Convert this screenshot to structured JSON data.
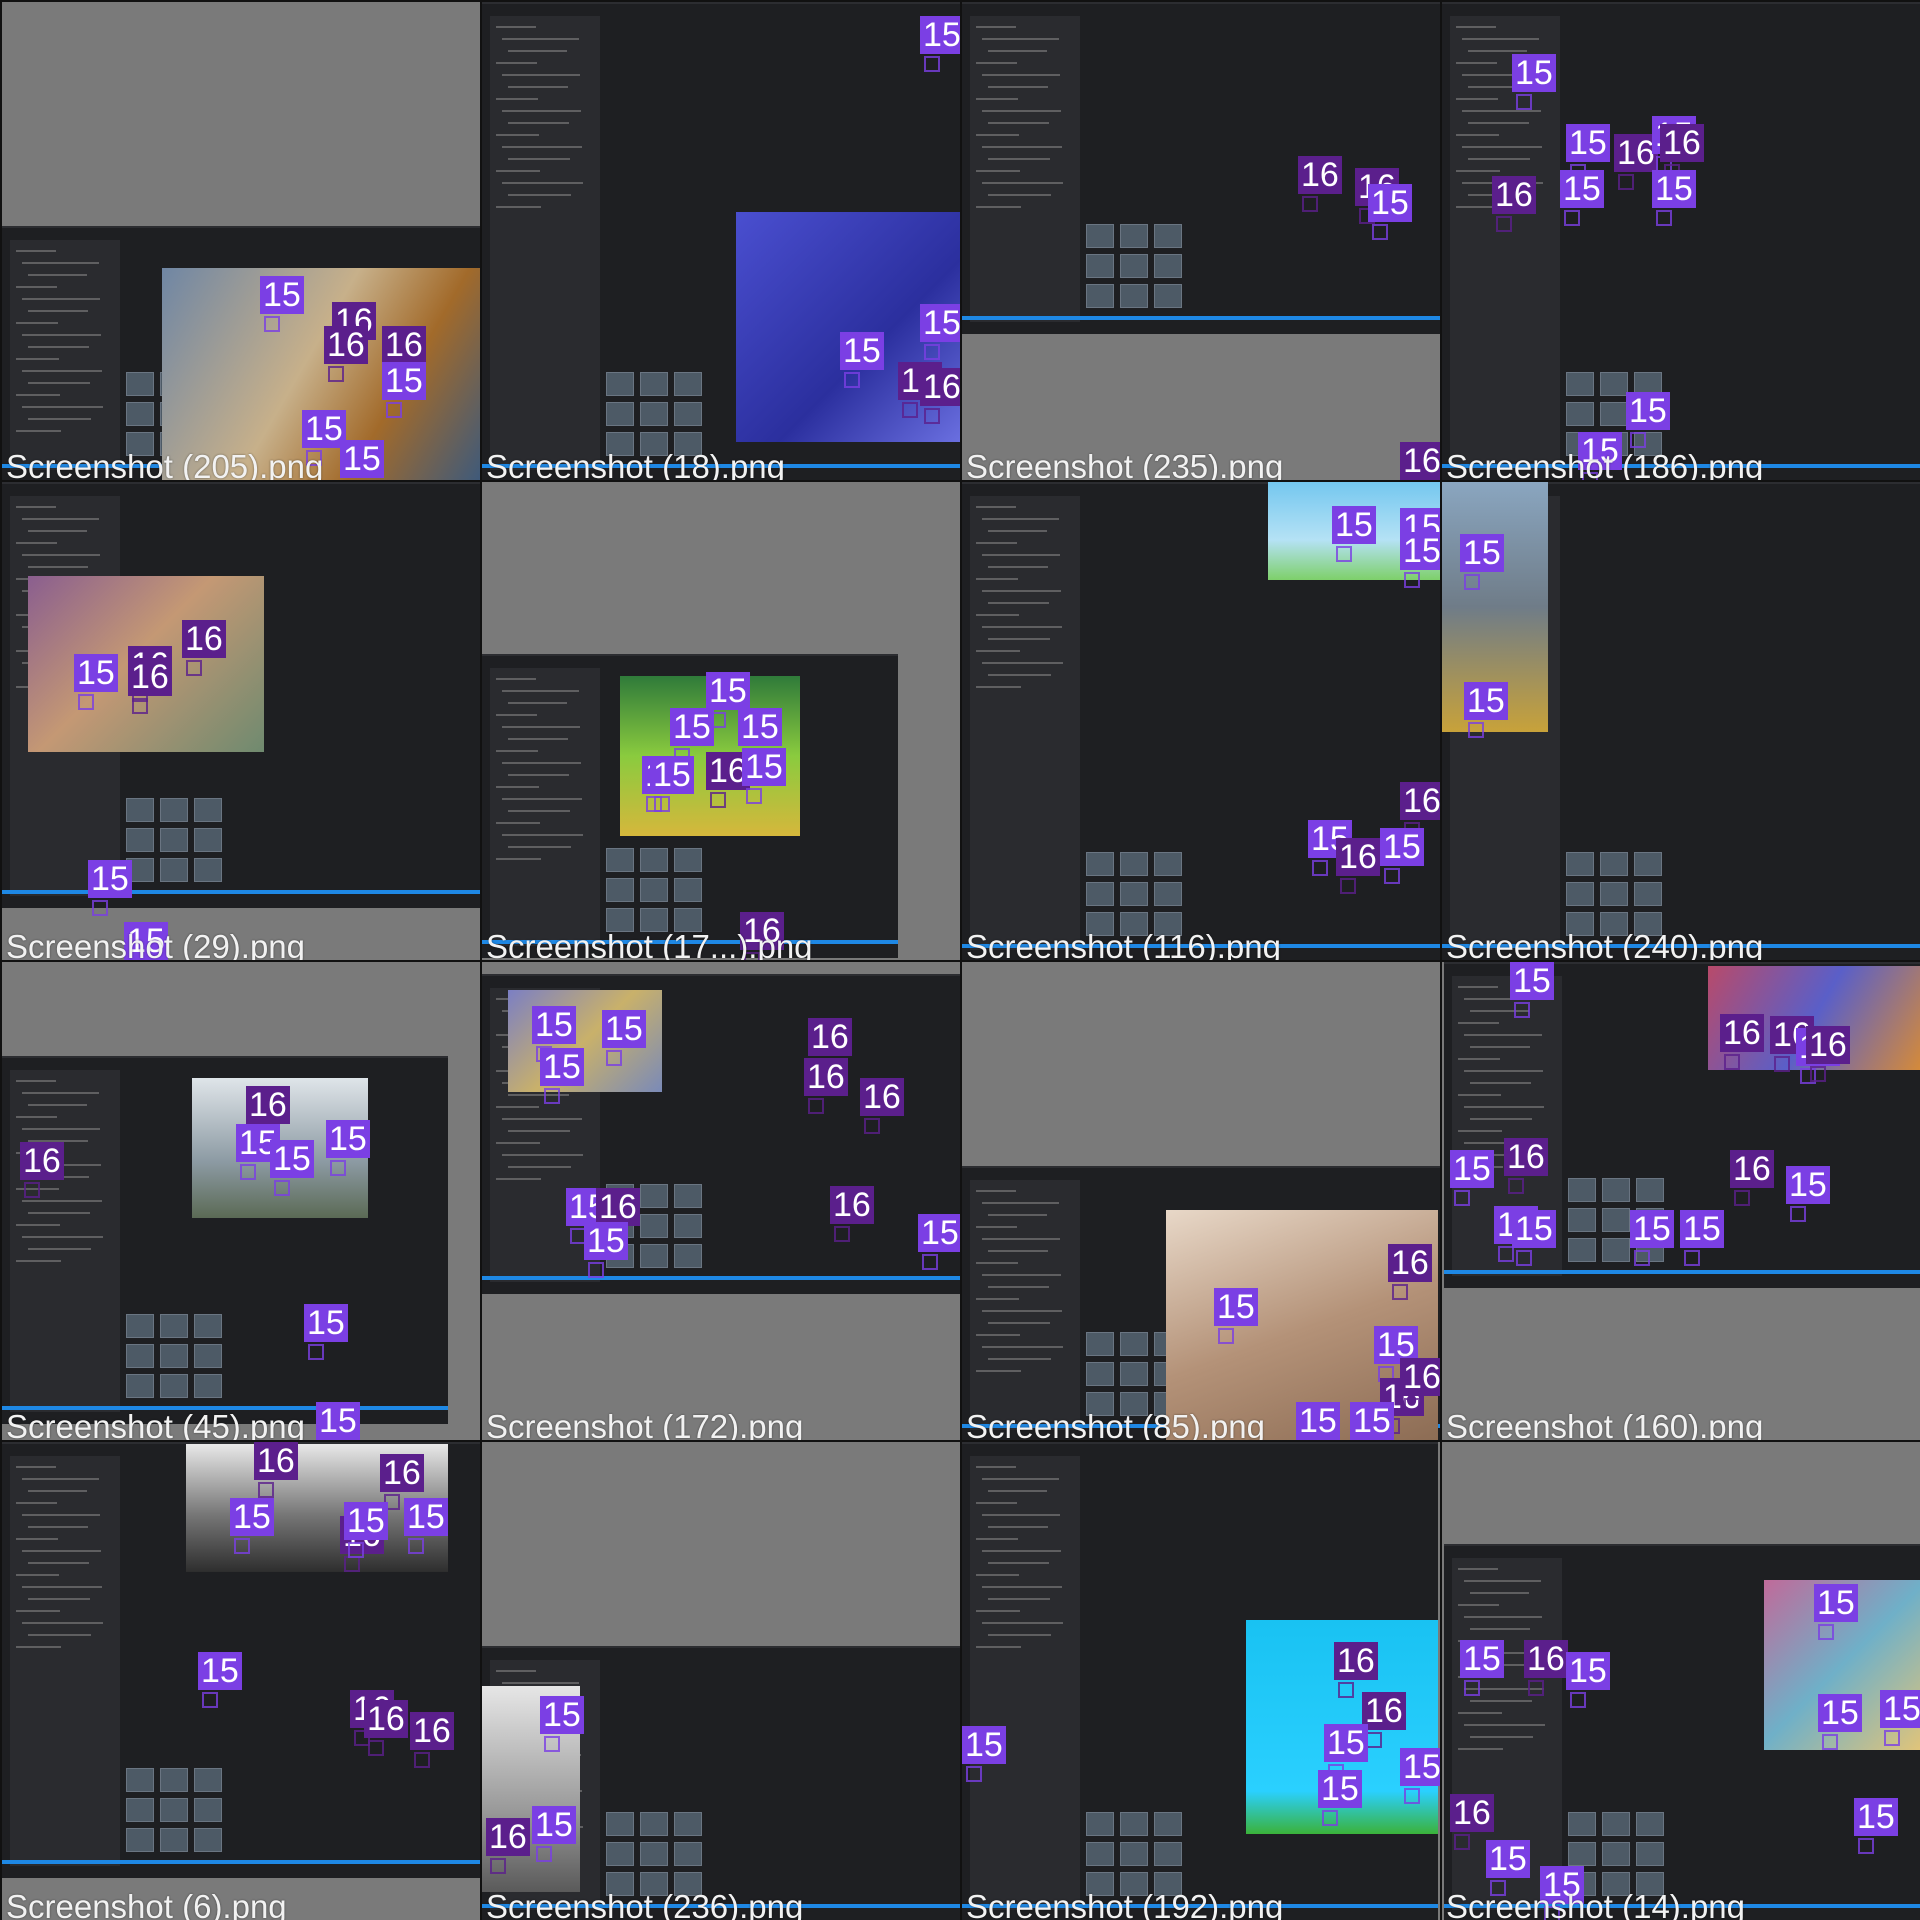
{
  "layout": "4x4 grid of annotated screenshots",
  "class_colors": {
    "15": "#7b3fe4",
    "16": "#5b1f8c"
  },
  "tiles": [
    {
      "caption": "Screenshot (205).png",
      "labels": [
        "15",
        "16",
        "16",
        "16",
        "15",
        "15",
        "15"
      ]
    },
    {
      "caption": "Screenshot (18).png",
      "labels": [
        "15",
        "15",
        "15",
        "16",
        "16"
      ]
    },
    {
      "caption": "Screenshot (235).png",
      "labels": [
        "16",
        "16",
        "15",
        "16",
        "16"
      ]
    },
    {
      "caption": "Screenshot (186).png",
      "labels": [
        "15",
        "15",
        "16",
        "15",
        "16",
        "16",
        "15",
        "15",
        "15",
        "15"
      ]
    },
    {
      "caption": "Screenshot (29).png",
      "labels": [
        "16",
        "16",
        "15",
        "16",
        "15",
        "15"
      ]
    },
    {
      "caption": "Screenshot (17...).png",
      "labels": [
        "15",
        "15",
        "15",
        "15",
        "16",
        "15",
        "15",
        "16"
      ]
    },
    {
      "caption": "Screenshot (116).png",
      "labels": [
        "15",
        "15",
        "15",
        "16",
        "15",
        "15",
        "16"
      ]
    },
    {
      "caption": "Screenshot (240).png",
      "labels": [
        "15",
        "15"
      ]
    },
    {
      "caption": "Screenshot (45).png",
      "labels": [
        "16",
        "16",
        "15",
        "15",
        "15",
        "15",
        "15"
      ]
    },
    {
      "caption": "Screenshot (172).png",
      "labels": [
        "15",
        "15",
        "15",
        "16",
        "16",
        "16",
        "15",
        "16",
        "15",
        "16",
        "15"
      ]
    },
    {
      "caption": "Screenshot (85).png",
      "labels": [
        "16",
        "15",
        "15",
        "16",
        "16",
        "15",
        "15"
      ]
    },
    {
      "caption": "Screenshot (160).png",
      "labels": [
        "15",
        "16",
        "16",
        "15",
        "16",
        "15",
        "16",
        "16",
        "15",
        "15",
        "15",
        "15",
        "15"
      ]
    },
    {
      "caption": "Screenshot (6).png",
      "labels": [
        "16",
        "16",
        "15",
        "16",
        "15",
        "15",
        "16",
        "16",
        "16",
        "15"
      ]
    },
    {
      "caption": "Screenshot (236).png",
      "labels": [
        "15",
        "16",
        "15"
      ]
    },
    {
      "caption": "Screenshot (192).png",
      "labels": [
        "15",
        "16",
        "16",
        "15",
        "15",
        "15"
      ]
    },
    {
      "caption": "Screenshot (14).png",
      "labels": [
        "15",
        "15",
        "16",
        "15",
        "15",
        "15",
        "16",
        "15",
        "15",
        "15"
      ]
    }
  ]
}
